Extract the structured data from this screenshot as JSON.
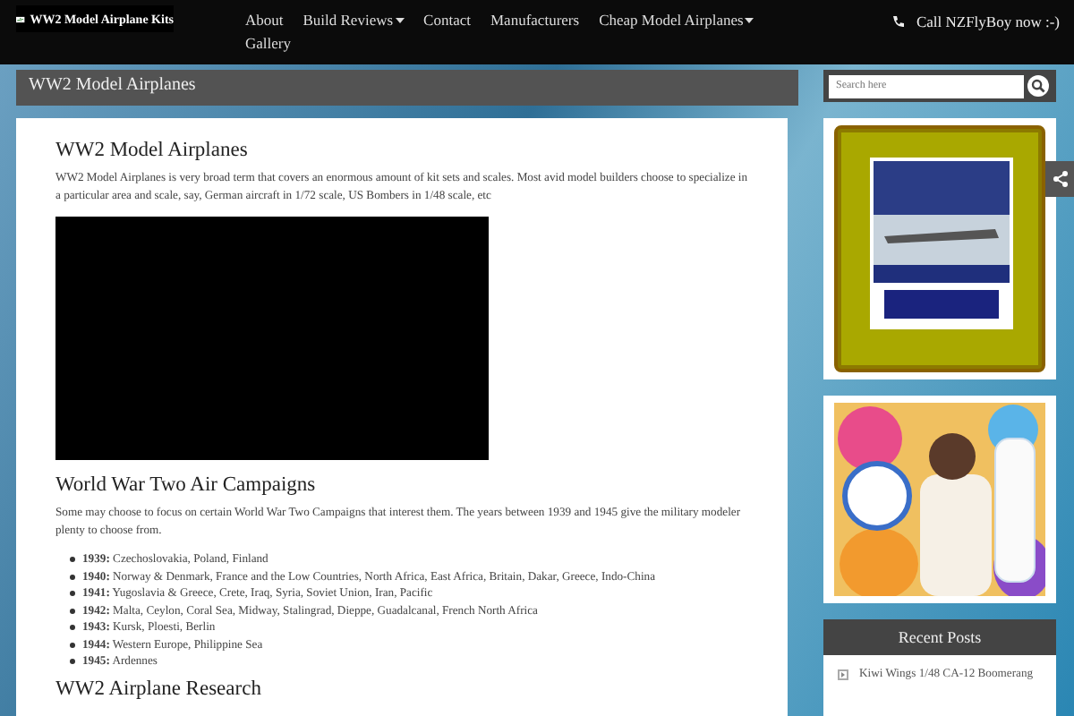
{
  "site": {
    "logo_text": "WW2 Model Airplane Kits"
  },
  "nav": [
    {
      "label": "About",
      "dropdown": false
    },
    {
      "label": "Build Reviews",
      "dropdown": true
    },
    {
      "label": "Contact",
      "dropdown": false
    },
    {
      "label": "Manufacturers",
      "dropdown": false
    },
    {
      "label": "Cheap Model Airplanes",
      "dropdown": true
    },
    {
      "label": "Gallery",
      "dropdown": false
    }
  ],
  "call": "Call NZFlyBoy now :-)",
  "page_title": "WW2 Model Airplanes",
  "article": {
    "heading": "WW2 Model Airplanes",
    "intro": "WW2 Model Airplanes is very broad term that covers an enormous amount of kit sets and scales. Most avid model builders choose to specialize in a particular area and scale, say, German aircraft in 1/72 scale, US Bombers in 1/48 scale, etc",
    "section_heading": "World War Two Air Campaigns",
    "section_text": "Some may choose to focus on certain World War Two Campaigns that interest them. The years between 1939 and 1945 give the military modeler plenty to choose from.",
    "campaigns": [
      {
        "year": "1939:",
        "places": "Czechoslovakia, Poland, Finland"
      },
      {
        "year": "1940:",
        "places": "Norway & Denmark, France and the Low Countries, North Africa, East Africa, Britain, Dakar, Greece, Indo-China"
      },
      {
        "year": "1941:",
        "places": "Yugoslavia & Greece, Crete, Iraq, Syria, Soviet Union, Iran, Pacific"
      },
      {
        "year": "1942:",
        "places": "Malta, Ceylon, Coral Sea, Midway, Stalingrad, Dieppe, Guadalcanal, French North Africa"
      },
      {
        "year": "1943:",
        "places": "Kursk, Ploesti, Berlin"
      },
      {
        "year": "1944:",
        "places": "Western Europe, Philippine Sea"
      },
      {
        "year": "1945:",
        "places": "Ardennes"
      }
    ],
    "research_heading": "WW2 Airplane Research"
  },
  "sidebar": {
    "search": {
      "placeholder": "Search here"
    },
    "recent_posts": {
      "title": "Recent Posts",
      "items": [
        "Kiwi Wings 1/48 CA-12 Boomerang"
      ]
    }
  }
}
